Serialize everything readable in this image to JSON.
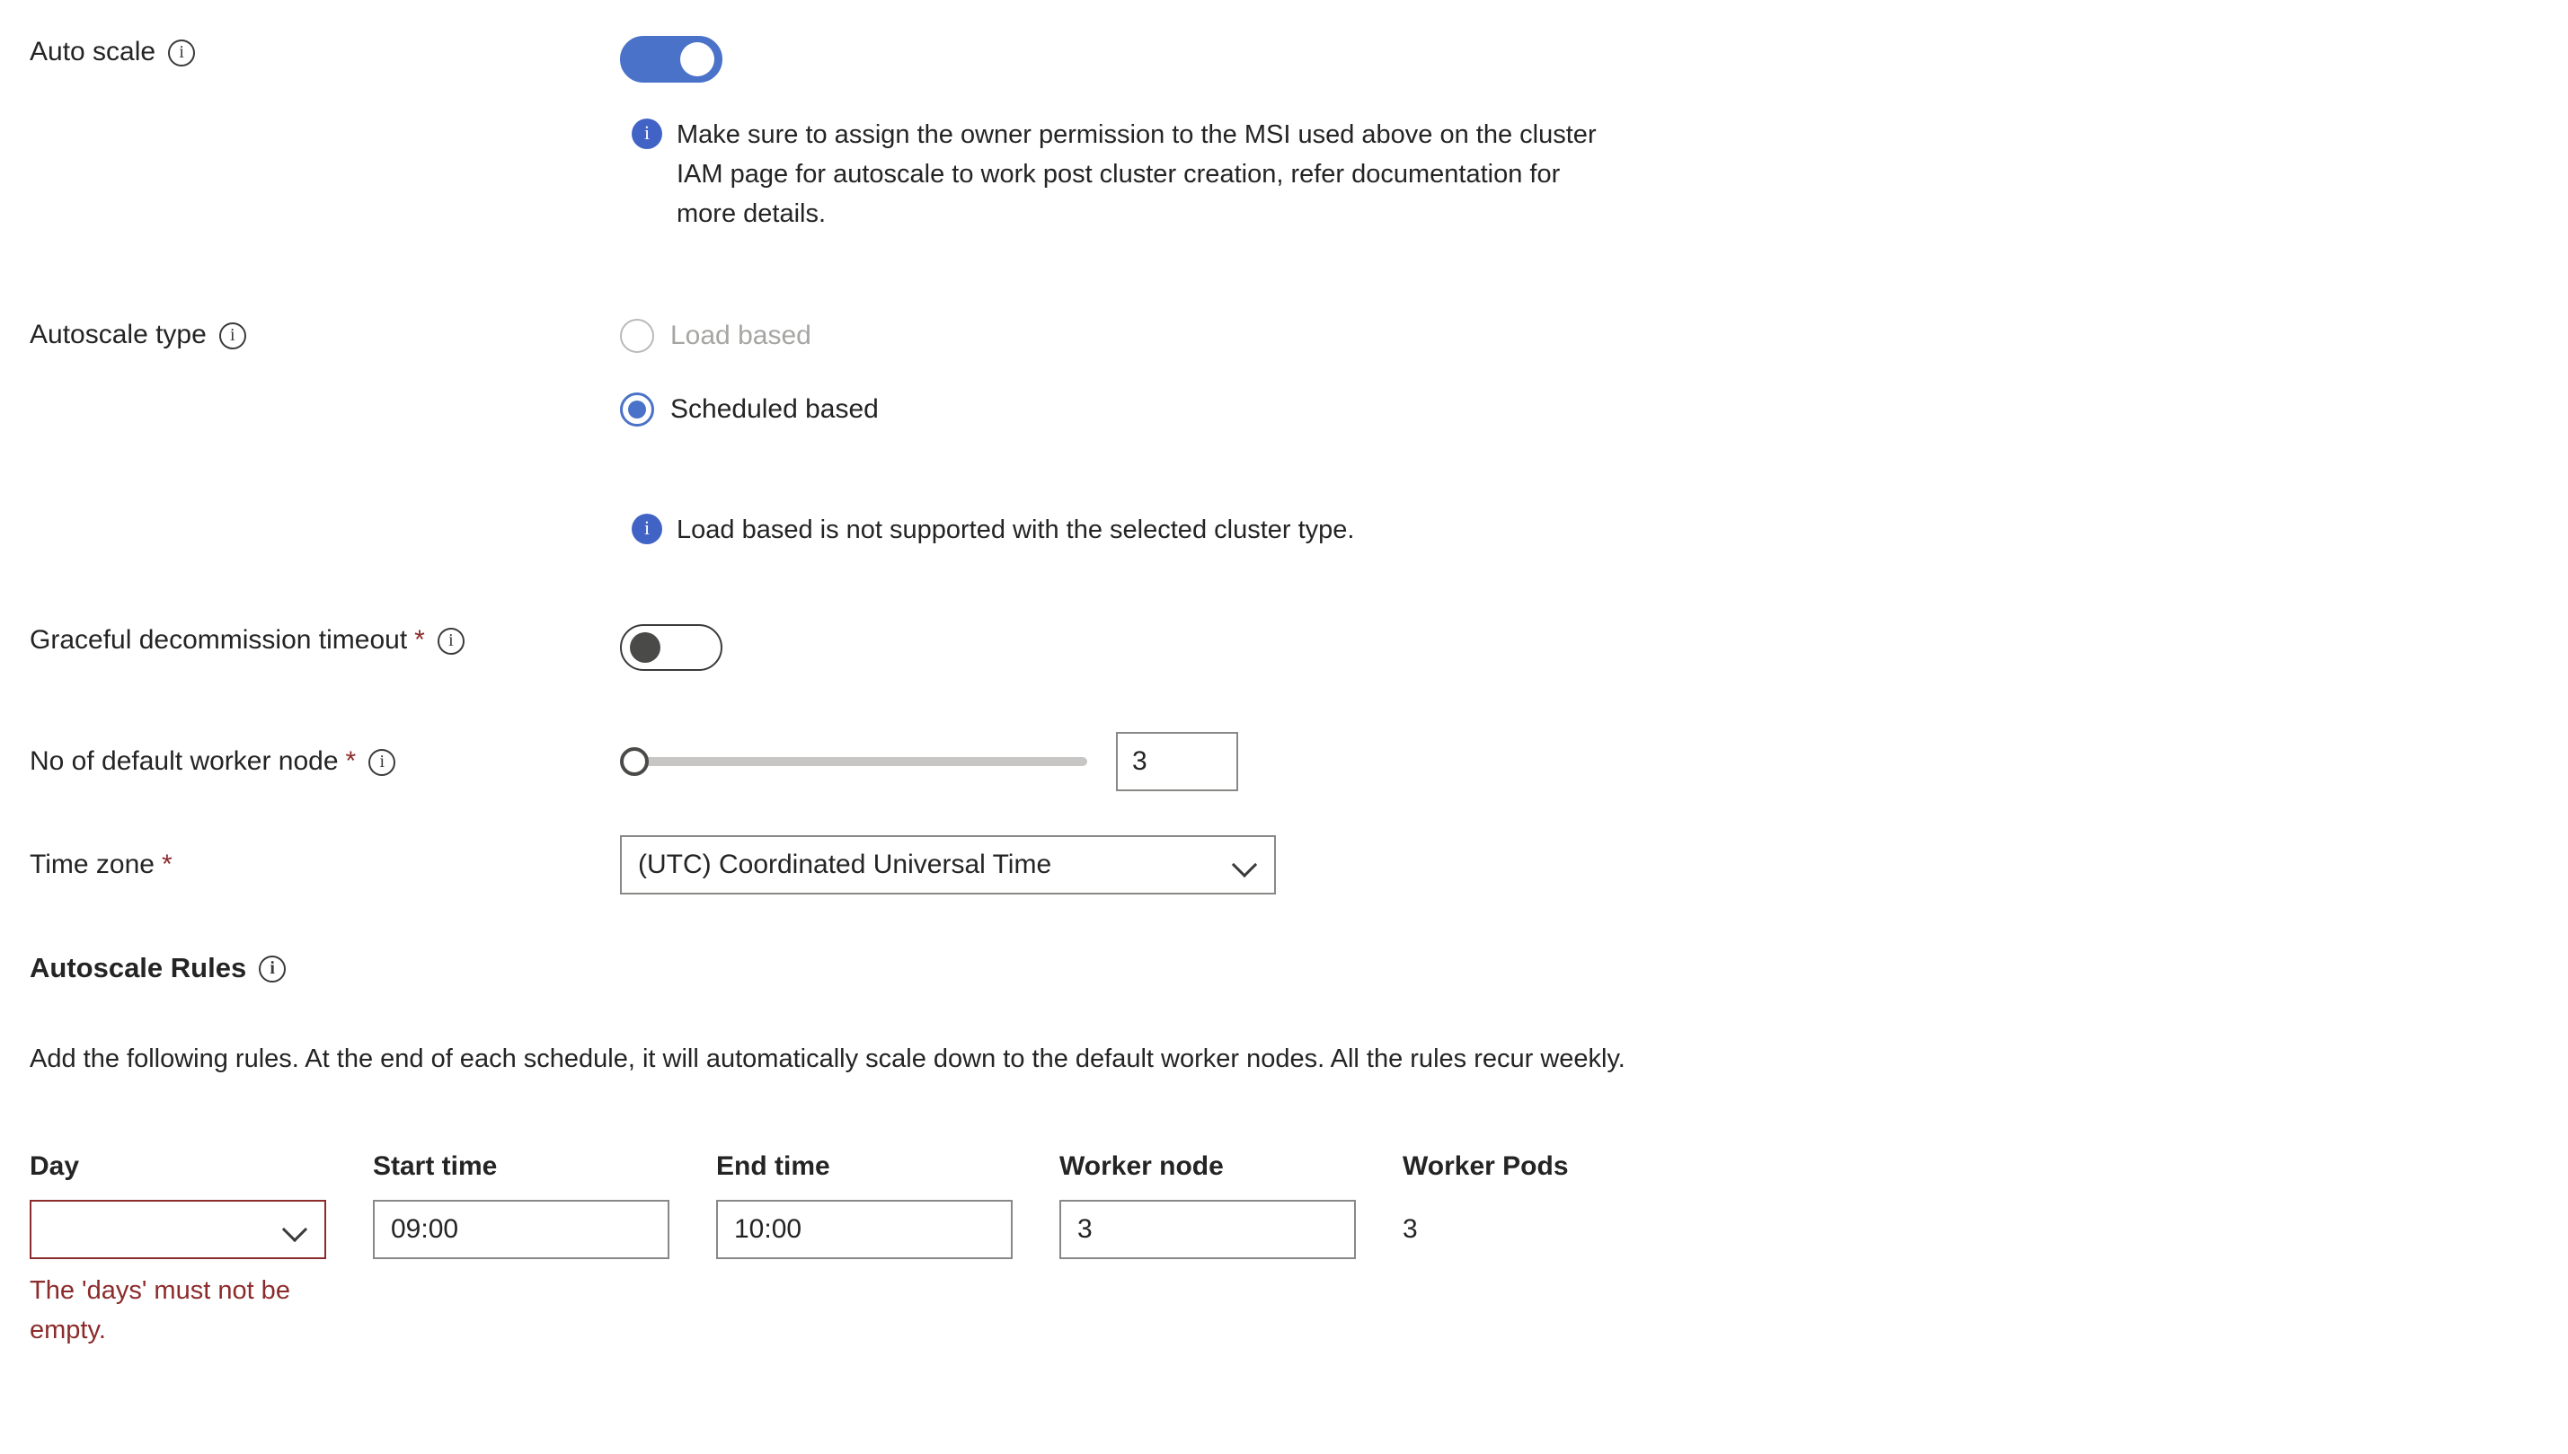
{
  "auto_scale": {
    "label": "Auto scale",
    "info_icon": "info-circle-icon",
    "toggle_state": "on",
    "notice": "Make sure to assign the owner permission to the MSI used above on the cluster IAM page for autoscale to work post cluster creation, refer documentation for more details.",
    "notice_icon": "info-filled-icon"
  },
  "autoscale_type": {
    "label": "Autoscale type",
    "info_icon": "info-circle-icon",
    "options": [
      {
        "label": "Load based",
        "selected": false,
        "disabled": true
      },
      {
        "label": "Scheduled based",
        "selected": true,
        "disabled": false
      }
    ],
    "notice": "Load based is not supported with the selected cluster type.",
    "notice_icon": "info-filled-icon"
  },
  "graceful_timeout": {
    "label": "Graceful decommission timeout",
    "required_mark": "*",
    "info_icon": "info-circle-icon",
    "toggle_state": "off"
  },
  "default_worker_node": {
    "label": "No of default worker node",
    "required_mark": "*",
    "info_icon": "info-circle-icon",
    "slider_value": "3",
    "value": "3"
  },
  "time_zone": {
    "label": "Time zone",
    "required_mark": "*",
    "value": "(UTC) Coordinated Universal Time",
    "chevron_icon": "chevron-down-icon"
  },
  "autoscale_rules": {
    "heading": "Autoscale Rules",
    "info_icon": "info-circle-icon",
    "description": "Add the following rules. At the end of each schedule, it will automatically scale down to the default worker nodes. All the rules recur weekly.",
    "columns": [
      "Day",
      "Start time",
      "End time",
      "Worker node",
      "Worker Pods"
    ],
    "rows": [
      {
        "day": "",
        "day_placeholder": "",
        "day_error": true,
        "start_time": "09:00",
        "end_time": "10:00",
        "worker_node": "3",
        "worker_pods": "3",
        "error_message": "The 'days' must not be empty."
      }
    ]
  },
  "colors": {
    "toggle_on": "#4a72c8",
    "radio_selected": "#4a72c8",
    "info_badge": "#4163c6",
    "error": "#8c2b2b",
    "border": "#8a8886",
    "text": "#242424",
    "disabled_text": "#a5a5a3",
    "slider_track": "#c8c6c4"
  }
}
